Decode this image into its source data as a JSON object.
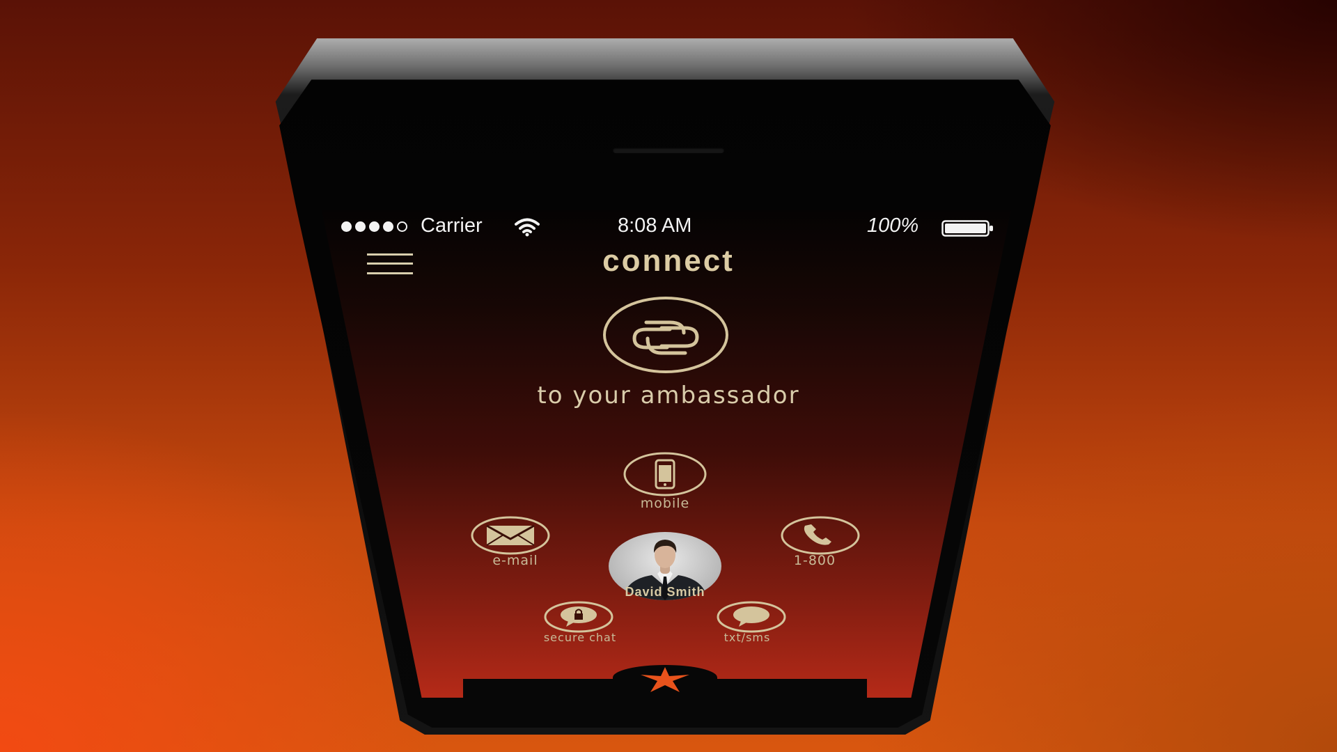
{
  "status_bar": {
    "carrier": "Carrier",
    "time": "8:08 AM",
    "battery": "100%",
    "signal_bars": 4,
    "signal_max": 5
  },
  "header": {
    "title": "connect",
    "menu_icon": "hamburger-menu-icon"
  },
  "hero": {
    "icon": "link-icon",
    "subtitle": "to your ambassador"
  },
  "actions": {
    "mobile": {
      "label": "mobile",
      "icon": "mobile-phone-icon"
    },
    "email": {
      "label": "e-mail",
      "icon": "envelope-icon"
    },
    "phone": {
      "label": "1-800",
      "icon": "telephone-icon"
    },
    "secure_chat": {
      "label": "secure chat",
      "icon": "lock-chat-icon"
    },
    "sms": {
      "label": "txt/sms",
      "icon": "speech-bubble-icon"
    }
  },
  "ambassador": {
    "name": "David Smith"
  },
  "tabbar": {
    "icon": "star-icon"
  },
  "colors": {
    "accent": "#dccca4",
    "screen_bottom": "#b52a18",
    "background": "#d8560f"
  }
}
